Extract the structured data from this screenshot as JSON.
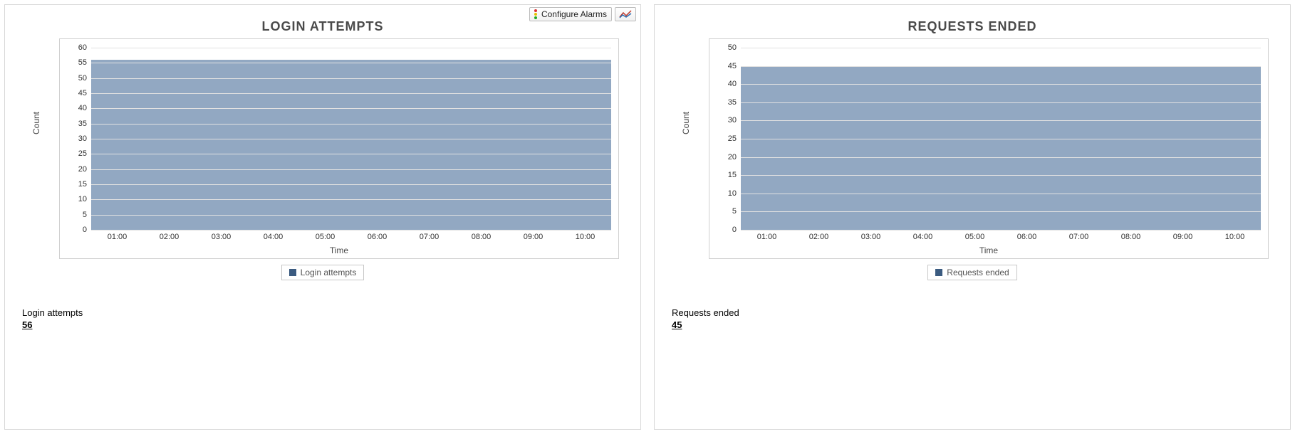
{
  "toolbar": {
    "configure_alarms": "Configure Alarms"
  },
  "chart_data": [
    {
      "type": "area",
      "title": "LOGIN ATTEMPTS",
      "xlabel": "Time",
      "ylabel": "Count",
      "x_ticks": [
        "01:00",
        "02:00",
        "03:00",
        "04:00",
        "05:00",
        "06:00",
        "07:00",
        "08:00",
        "09:00",
        "10:00"
      ],
      "y_ticks": [
        0,
        5,
        10,
        15,
        20,
        25,
        30,
        35,
        40,
        45,
        50,
        55,
        60
      ],
      "ylim": [
        0,
        60
      ],
      "series": [
        {
          "name": "Login attempts",
          "value": 56
        }
      ],
      "legend": "Login attempts",
      "summary": {
        "label": "Login attempts",
        "value": "56"
      }
    },
    {
      "type": "area",
      "title": "REQUESTS ENDED",
      "xlabel": "Time",
      "ylabel": "Count",
      "x_ticks": [
        "01:00",
        "02:00",
        "03:00",
        "04:00",
        "05:00",
        "06:00",
        "07:00",
        "08:00",
        "09:00",
        "10:00"
      ],
      "y_ticks": [
        0,
        5,
        10,
        15,
        20,
        25,
        30,
        35,
        40,
        45,
        50
      ],
      "ylim": [
        0,
        50
      ],
      "series": [
        {
          "name": "Requests ended",
          "value": 45
        }
      ],
      "legend": "Requests ended",
      "summary": {
        "label": "Requests ended",
        "value": "45"
      }
    }
  ]
}
